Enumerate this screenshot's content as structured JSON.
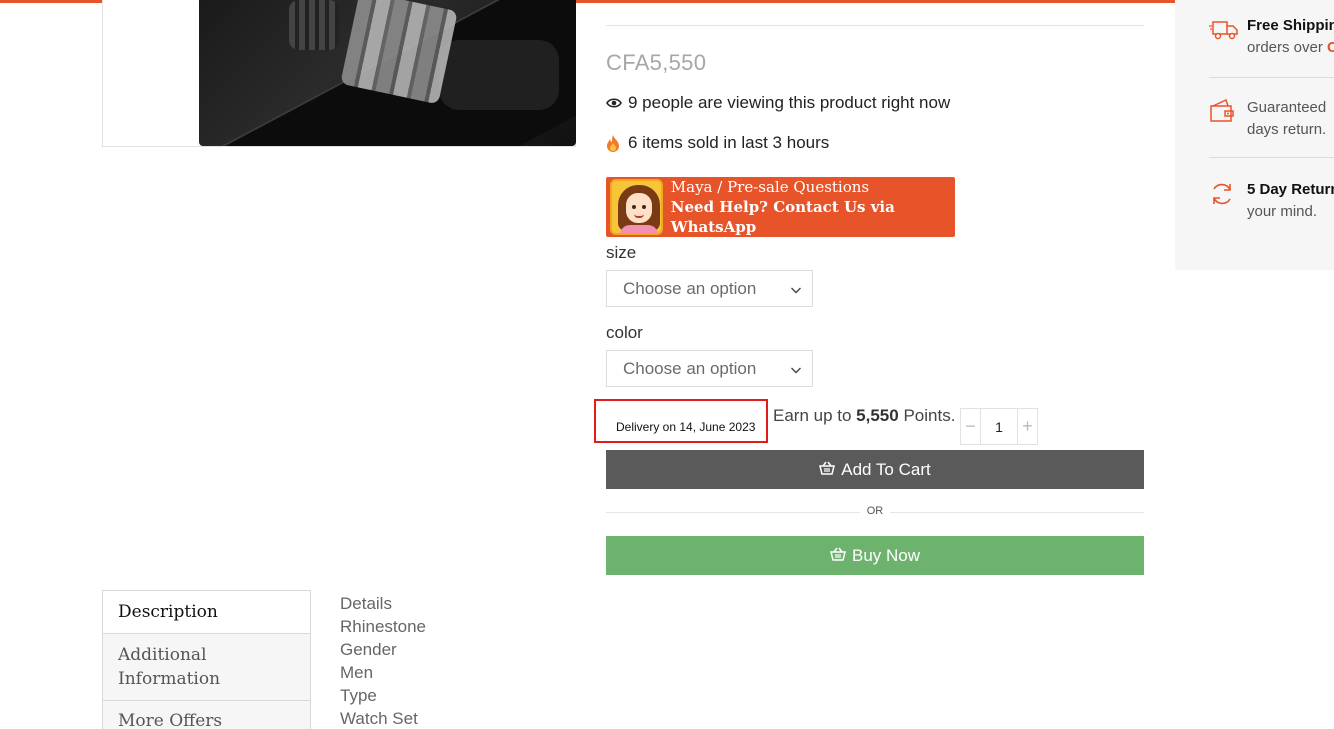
{
  "product": {
    "price": "CFA5,550",
    "viewing_text": "9 people are viewing this product right now",
    "sold_text": "6 items sold in last 3 hours",
    "whatsapp": {
      "line1": "Maya / Pre-sale Questions",
      "line2": "Need Help? Contact Us via WhatsApp"
    },
    "options": [
      {
        "label": "size",
        "selected": "Choose an option"
      },
      {
        "label": "color",
        "selected": "Choose an option"
      }
    ],
    "delivery": "Delivery on 14, June 2023",
    "points": {
      "prefix": "Earn up to ",
      "value": "5,550",
      "suffix": " Points."
    },
    "quantity": "1",
    "qty_minus": "−",
    "qty_plus": "+",
    "add_to_cart": "Add To Cart",
    "or_label": "OR",
    "buy_now": "Buy Now"
  },
  "sidebar": {
    "shipping": {
      "title": "Free Shippin",
      "line2_prefix": "orders over ",
      "line2_accent": "C"
    },
    "guarantee": {
      "line1": "Guaranteed ",
      "line2": "days return."
    },
    "returns": {
      "title": "5 Day Return",
      "line2": "your mind."
    }
  },
  "tabs": [
    {
      "label": "Description"
    },
    {
      "label": "Additional Information"
    },
    {
      "label": "More Offers"
    }
  ],
  "details": [
    "Details",
    "Rhinestone",
    "Gender",
    "Men",
    "Type",
    "Watch Set"
  ],
  "colors": {
    "accent": "#e8542a",
    "buy_now": "#6db36e",
    "add_to_cart": "#5a5a5a",
    "highlight_border": "#e21b1b"
  }
}
